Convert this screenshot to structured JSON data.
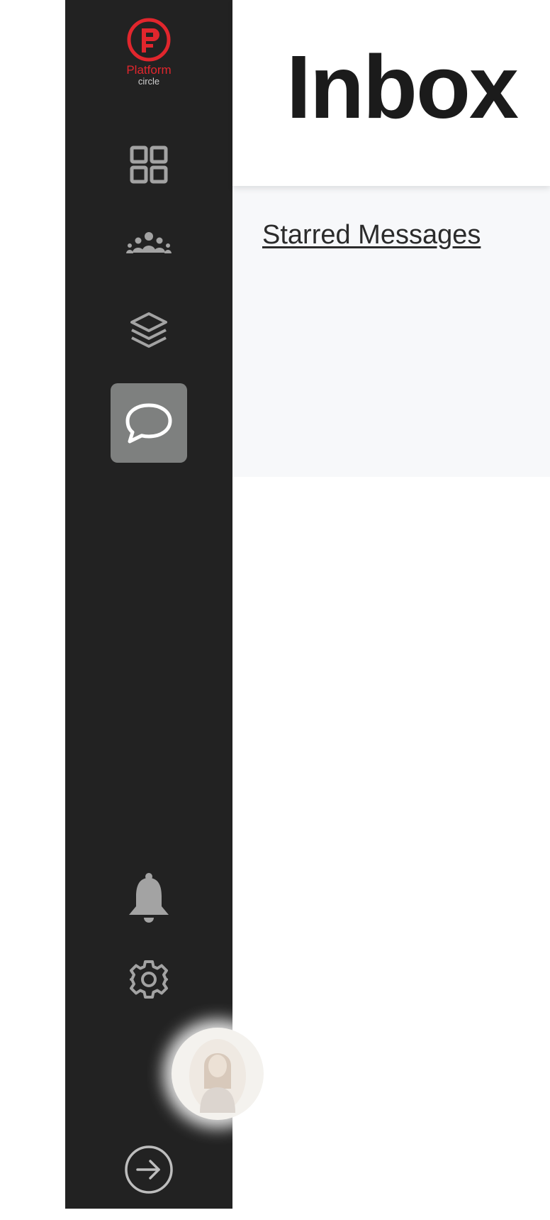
{
  "brand": {
    "name": "Platform",
    "sub": "circle",
    "accent_color": "#e1262d"
  },
  "sidebar": {
    "background": "#222222",
    "active_background": "#7e807f",
    "items": [
      {
        "icon": "dashboard-grid-icon",
        "active": false
      },
      {
        "icon": "team-people-icon",
        "active": false
      },
      {
        "icon": "layers-stack-icon",
        "active": false
      },
      {
        "icon": "chat-bubble-icon",
        "active": true
      }
    ],
    "bottom_items": [
      {
        "icon": "bell-icon"
      },
      {
        "icon": "gear-icon"
      },
      {
        "icon": "avatar"
      },
      {
        "icon": "logout-arrow-icon"
      }
    ]
  },
  "header": {
    "title": "Inbox"
  },
  "subpanel": {
    "link_label": "Starred Messages"
  }
}
